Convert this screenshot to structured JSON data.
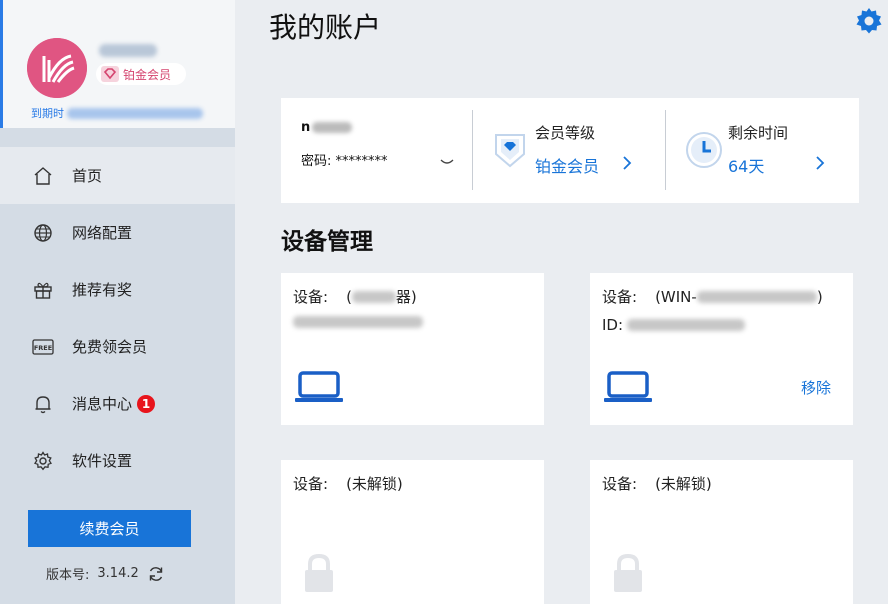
{
  "sidebar": {
    "vip_label": "铂金会员",
    "expire_label": "到期时",
    "nav": [
      {
        "label": "首页",
        "icon": "home-icon",
        "active": true
      },
      {
        "label": "网络配置",
        "icon": "globe-icon"
      },
      {
        "label": "推荐有奖",
        "icon": "gift-icon"
      },
      {
        "label": "免费领会员",
        "icon": "free-icon",
        "icon_text": "FREE"
      },
      {
        "label": "消息中心",
        "icon": "bell-icon",
        "badge": "1"
      },
      {
        "label": "软件设置",
        "icon": "gear-icon"
      }
    ],
    "renew_label": "续费会员",
    "version_label": "版本号:",
    "version_value": "3.14.2"
  },
  "header": {
    "title": "我的账户"
  },
  "account": {
    "name_prefix": "n",
    "password_label": "密码:",
    "password_value": "********"
  },
  "level": {
    "label": "会员等级",
    "value": "铂金会员"
  },
  "remaining": {
    "label": "剩余时间",
    "value": "64天"
  },
  "devices": {
    "section_title": "设备管理",
    "items": [
      {
        "line1_label": "设备:",
        "line1_value": "(",
        "line1_suffix": "器)",
        "line2_value": "",
        "remove": ""
      },
      {
        "line1_label": "设备:",
        "line1_value": "(WIN-",
        "line1_suffix": ")",
        "line2_value": "ID:",
        "remove": "移除"
      },
      {
        "line1_label": "设备:",
        "line1_value": "(未解锁)"
      },
      {
        "line1_label": "设备:",
        "line1_value": "(未解锁)"
      }
    ]
  },
  "colors": {
    "accent": "#1874d8",
    "sidebar_bg": "#d4dce5",
    "main_bg": "#eaedf1",
    "avatar": "#e05582",
    "badge_red": "#e8141c"
  }
}
